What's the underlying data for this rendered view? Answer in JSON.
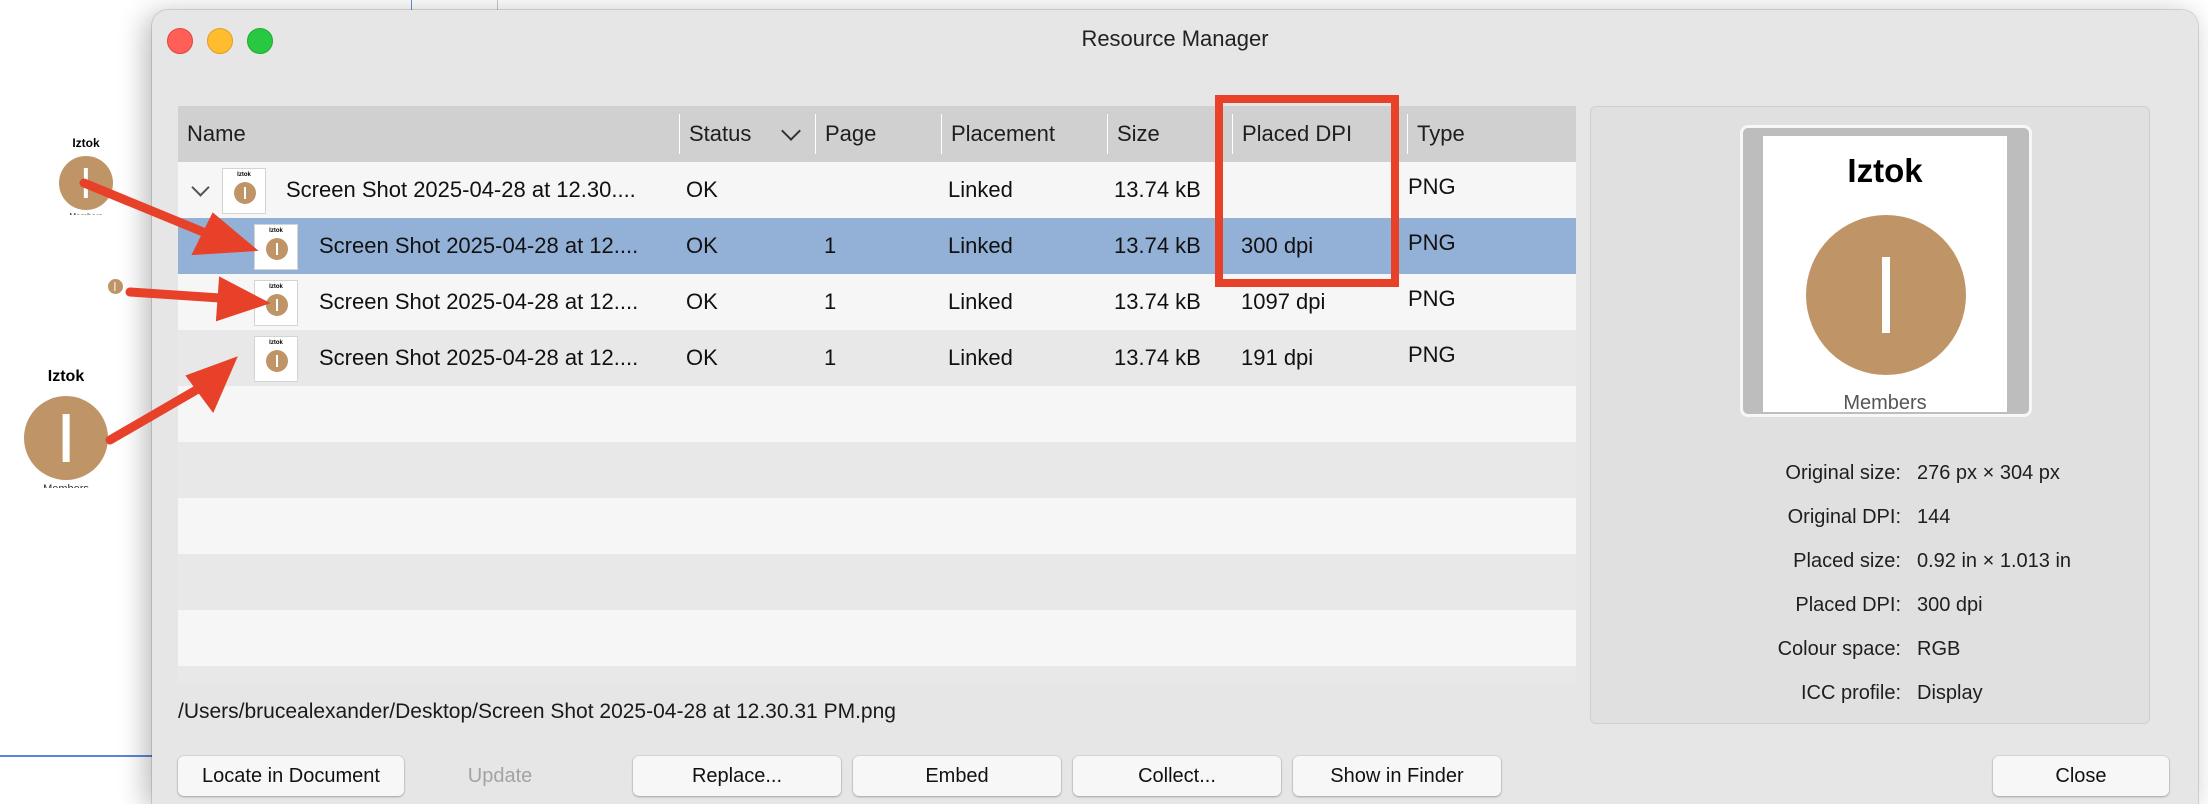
{
  "window": {
    "title": "Resource Manager"
  },
  "table": {
    "columns": [
      "Name",
      "Status",
      "Page",
      "Placement",
      "Size",
      "Placed DPI",
      "Type"
    ],
    "rows": [
      {
        "name": "Screen Shot 2025-04-28 at 12.30....",
        "status": "OK",
        "page": "",
        "placement": "Linked",
        "size": "13.74 kB",
        "placed_dpi": "",
        "type": "PNG"
      },
      {
        "name": "Screen Shot 2025-04-28 at 12....",
        "status": "OK",
        "page": "1",
        "placement": "Linked",
        "size": "13.74 kB",
        "placed_dpi": "300 dpi",
        "type": "PNG"
      },
      {
        "name": "Screen Shot 2025-04-28 at 12....",
        "status": "OK",
        "page": "1",
        "placement": "Linked",
        "size": "13.74 kB",
        "placed_dpi": "1097 dpi",
        "type": "PNG"
      },
      {
        "name": "Screen Shot 2025-04-28 at 12....",
        "status": "OK",
        "page": "1",
        "placement": "Linked",
        "size": "13.74 kB",
        "placed_dpi": "191 dpi",
        "type": "PNG"
      }
    ]
  },
  "file_path": "/Users/brucealexander/Desktop/Screen Shot 2025-04-28 at 12.30.31 PM.png",
  "preview": {
    "image_title": "Iztok",
    "image_caption": "Members",
    "info": [
      {
        "label": "Original size:",
        "value": "276 px × 304 px"
      },
      {
        "label": "Original DPI:",
        "value": "144"
      },
      {
        "label": "Placed size:",
        "value": "0.92 in × 1.013 in"
      },
      {
        "label": "Placed DPI:",
        "value": "300 dpi"
      },
      {
        "label": "Colour space:",
        "value": "RGB"
      },
      {
        "label": "ICC profile:",
        "value": "Display"
      }
    ]
  },
  "buttons": {
    "locate": "Locate in Document",
    "update": "Update",
    "replace": "Replace...",
    "embed": "Embed",
    "collect": "Collect...",
    "show_in_finder": "Show in Finder",
    "close": "Close"
  },
  "document": {
    "small_title": "Iztok",
    "small_caption": "Members",
    "large_title": "Iztok",
    "large_caption": "Members"
  },
  "colors": {
    "accent_selected_row": "#93b1d7",
    "annotation_red": "#e8412a",
    "avatar_tan": "#bf9568"
  },
  "icons": [
    "close-window-icon",
    "minimize-window-icon",
    "zoom-window-icon",
    "sort-chevron-icon",
    "disclosure-chevron-icon",
    "annotation-arrow-icon"
  ]
}
